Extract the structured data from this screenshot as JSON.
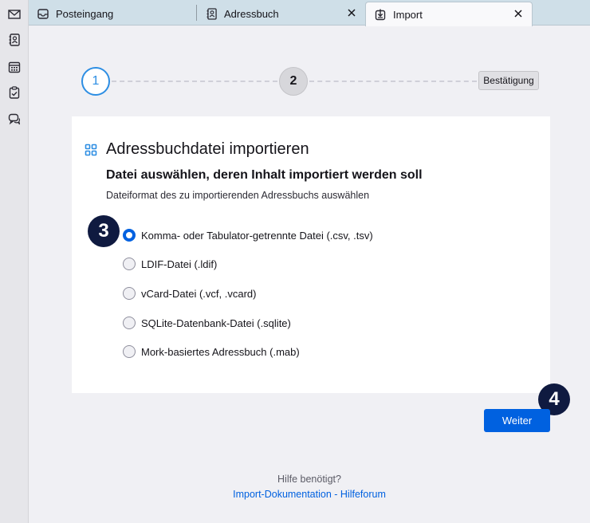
{
  "sidebar": {
    "items": [
      {
        "icon": "mail-icon"
      },
      {
        "icon": "address-book-icon"
      },
      {
        "icon": "calendar-icon"
      },
      {
        "icon": "tasks-icon"
      },
      {
        "icon": "chat-icon"
      }
    ]
  },
  "tabs": [
    {
      "label": "Posteingang",
      "icon": "inbox-icon",
      "active": false,
      "closable": false
    },
    {
      "label": "Adressbuch",
      "icon": "address-book-icon",
      "active": false,
      "closable": true
    },
    {
      "label": "Import",
      "icon": "import-icon",
      "active": true,
      "closable": true
    }
  ],
  "steps": {
    "step1": "1",
    "step2": "2",
    "step3": "Bestätigung"
  },
  "card": {
    "title": "Adressbuchdatei importieren",
    "subtitle": "Datei auswählen, deren Inhalt importiert werden soll",
    "description": "Dateiformat des zu importierenden Adressbuchs auswählen",
    "options": [
      {
        "label": "Komma- oder Tabulator-getrennte Datei (.csv, .tsv)",
        "checked": true
      },
      {
        "label": "LDIF-Datei (.ldif)",
        "checked": false
      },
      {
        "label": "vCard-Datei (.vcf, .vcard)",
        "checked": false
      },
      {
        "label": "SQLite-Datenbank-Datei (.sqlite)",
        "checked": false
      },
      {
        "label": "Mork-basiertes Adressbuch (.mab)",
        "checked": false
      }
    ]
  },
  "badges": {
    "options": "3",
    "next": "4"
  },
  "next_button": "Weiter",
  "help": {
    "question": "Hilfe benötigt?",
    "docs_link": "Import-Dokumentation",
    "separator": " - ",
    "forum_link": "Hilfeforum"
  },
  "colors": {
    "accent": "#0061e0",
    "step_active": "#2d8ee3",
    "badge": "#0f1a40"
  }
}
